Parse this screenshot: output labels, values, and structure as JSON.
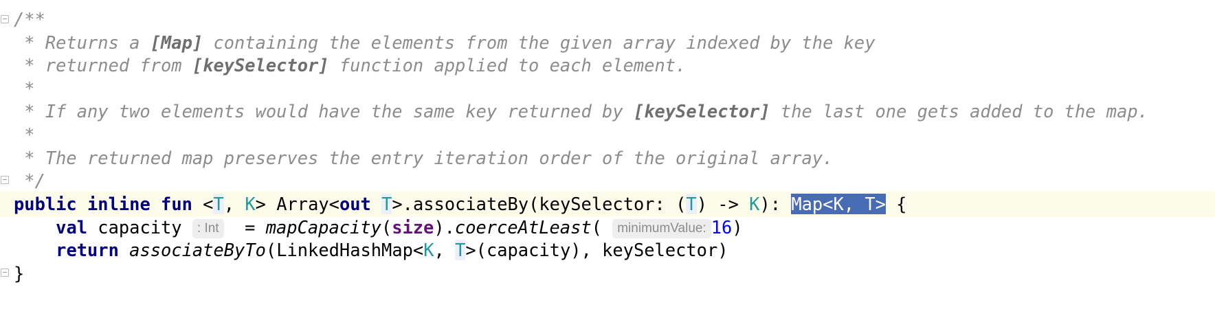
{
  "code": {
    "l1": {
      "text": "/**"
    },
    "l2": {
      "pre": " * Returns a ",
      "link": "[Map]",
      "post": " containing the elements from the given array indexed by the key"
    },
    "l3": {
      "pre": " * returned from ",
      "link": "[keySelector]",
      "post": " function applied to each element."
    },
    "l4": {
      "text": " *"
    },
    "l5": {
      "pre": " * If any two elements would have the same key returned by ",
      "link": "[keySelector]",
      "post": " the last one gets added to the map."
    },
    "l6": {
      "text": " *"
    },
    "l7": {
      "text": " * The returned map preserves the entry iteration order of the original array."
    },
    "l8": {
      "text": " */"
    },
    "l9": {
      "kw_public": "public",
      "kw_inline": "inline",
      "kw_fun": "fun",
      "open_generic": " <",
      "tp_t": "T",
      "comma": ", ",
      "tp_k": "K",
      "gt_array": "> Array<",
      "kw_out": "out",
      "tp_t2": "T",
      "assoc": ">.associateBy(keySelector: (",
      "tp_t3": "T",
      "arrow": ") -> ",
      "tp_k2": "K",
      "colon": "): ",
      "selected": "Map<K, T>",
      "brace": " {"
    },
    "l10": {
      "kw_val": "val",
      "name": " capacity ",
      "hint_type": ": Int",
      "eq": "  = ",
      "fn_mapcap": "mapCapacity",
      "paren1": "(",
      "prop_size": "size",
      "paren2": ").",
      "fn_coerce": "coerceAtLeast",
      "paren3": "( ",
      "hint_param": "minimumValue:",
      "num": "16",
      "paren4": ")"
    },
    "l11": {
      "kw_return": "return",
      "fn_assocto": "associateByTo",
      "lhm": "(LinkedHashMap<",
      "tp_k": "K",
      "comma": ", ",
      "tp_t": "T",
      "rest": ">(capacity), keySelector)"
    },
    "l12": {
      "text": "}"
    }
  }
}
